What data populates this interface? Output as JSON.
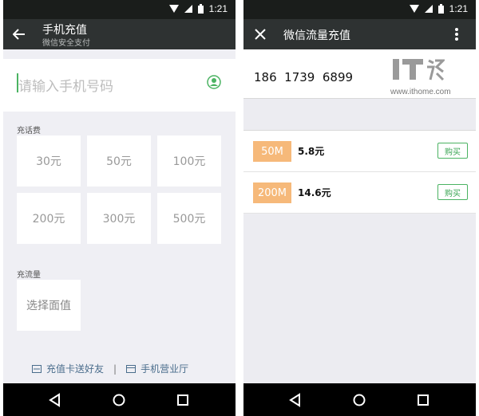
{
  "status_bar": {
    "time": "1:21"
  },
  "left_screen": {
    "title": "手机充值",
    "subtitle": "微信安全支付",
    "phone_input_placeholder": "请输入手机号码",
    "recharge_label": "充话费",
    "amounts": [
      "30元",
      "50元",
      "100元",
      "200元",
      "300元",
      "500元"
    ],
    "data_label": "充流量",
    "data_select": "选择面值",
    "footer": {
      "gift_card": "充值卡送好友",
      "mobile_hall": "手机营业厅"
    }
  },
  "right_screen": {
    "title": "微信流量充值",
    "phone_number": "186  1739  6899",
    "packages": [
      {
        "size": "50M",
        "price": "5.8元",
        "buy": "购买"
      },
      {
        "size": "200M",
        "price": "14.6元",
        "buy": "购买"
      }
    ]
  },
  "watermark": {
    "logo": "IT之家",
    "url": "www.ithome.com"
  },
  "colors": {
    "accent_green": "#4bb362",
    "tag_orange": "#f6b97a",
    "title_bar": "#2e3232"
  }
}
